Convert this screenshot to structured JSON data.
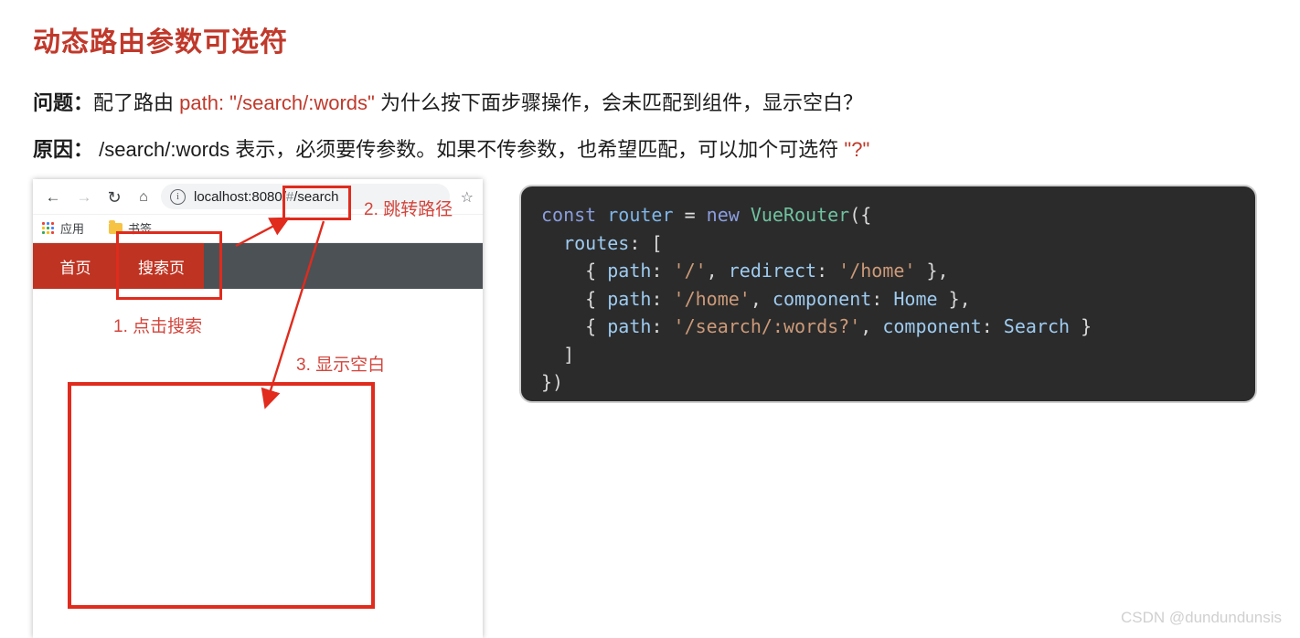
{
  "page": {
    "title": "动态路由参数可选符",
    "title_color": "#c0392b"
  },
  "prose": {
    "line1": {
      "label": "问题：",
      "text_before": "配了路由 ",
      "highlight": "path: \"/search/:words\"",
      "text_after": " 为什么按下面步骤操作，会未匹配到组件，显示空白？"
    },
    "line2": {
      "label": "原因：",
      "text_before": " /search/:words 表示，必须要传参数。如果不传参数，也希望匹配，可以加个可选符 ",
      "highlight": "\"?\"",
      "text_after": ""
    }
  },
  "browser": {
    "toolbar": {
      "back_icon": "arrow-left-icon",
      "forward_icon": "arrow-right-icon",
      "reload_icon": "reload-icon",
      "home_icon": "home-icon",
      "info_icon": "info-circle-icon",
      "star_icon": "star-icon",
      "url_host": "localhost:8080/",
      "url_hash": "#",
      "url_path": "/search"
    },
    "bookmarks": {
      "apps_label": "应用",
      "bookmarks_label": "书签"
    },
    "site_nav": {
      "links": [
        {
          "label": "首页"
        },
        {
          "label": "搜索页"
        }
      ],
      "bar_bg": "#4b5155",
      "link_bg": "#bf3322"
    },
    "annotations": [
      {
        "id": "step1",
        "text": "1. 点击搜索"
      },
      {
        "id": "step2",
        "text": "2. 跳转路径"
      },
      {
        "id": "step3",
        "text": "3. 显示空白"
      }
    ],
    "annotation_color": "#e02b1d"
  },
  "code": {
    "lines": [
      "const router = new VueRouter({",
      "  routes: [",
      "    { path: '/', redirect: '/home' },",
      "    { path: '/home', component: Home },",
      "    { path: '/search/:words?', component: Search }",
      "  ]",
      "})"
    ],
    "background": "#2b2b2b",
    "tokens": {
      "const": "const",
      "router": "router",
      "equals": "=",
      "new": "new",
      "vuerouter": "VueRouter",
      "open_paren_brace": "({",
      "routes": "routes",
      "open_bracket": "[",
      "path": "path",
      "redirect": "redirect",
      "component": "component",
      "str_root": "'/'",
      "str_home": "'/home'",
      "str_search": "'/search/:words?'",
      "home": "Home",
      "search": "Search",
      "close_bracket": "]",
      "close_brace_paren": "})"
    }
  },
  "watermark": {
    "text": "CSDN @dundundunsis"
  }
}
